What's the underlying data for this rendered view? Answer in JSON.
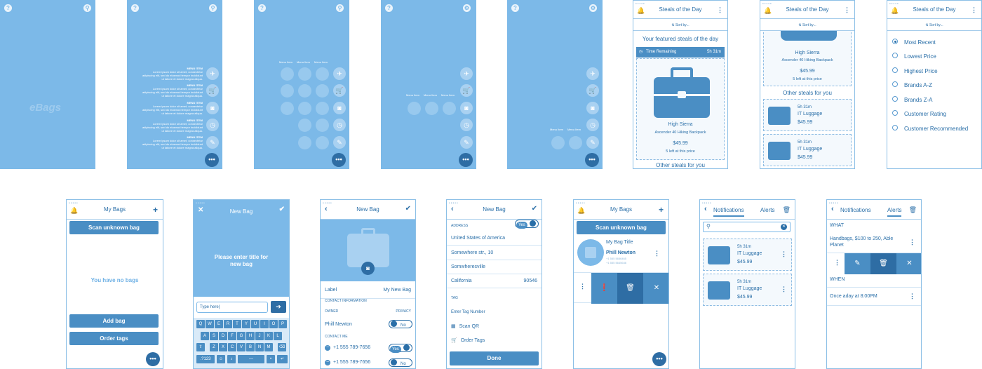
{
  "logo": "eBags",
  "sidemenu": {
    "items": [
      {
        "title": "MENU ITEM",
        "desc": "Lorem ipsum dolor sit amet, consectetur adipiscing elit, sed do eiusmod tempor incididunt ut labore et dolore magna aliqua."
      },
      {
        "title": "MENU ITEM",
        "desc": "Lorem ipsum dolor sit amet, consectetur adipiscing elit, sed do eiusmod tempor incididunt ut labore et dolore magna aliqua."
      },
      {
        "title": "MENU ITEM",
        "desc": "Lorem ipsum dolor sit amet, consectetur adipiscing elit, sed do eiusmod tempor incididunt ut labore et dolore magna aliqua."
      },
      {
        "title": "MENU ITEM",
        "desc": "Lorem ipsum dolor sit amet, consectetur adipiscing elit, sed do eiusmod tempor incididunt ut labore et dolore magna aliqua."
      },
      {
        "title": "MENU ITEM",
        "desc": "Lorem ipsum dolor sit amet, consectetur adipiscing elit, sed do eiusmod tempor incididunt ut labore et dolore magna aliqua."
      }
    ],
    "grid_label": "Menu Item"
  },
  "steals": {
    "title": "Steals of the Day",
    "sort": "Sort by...",
    "featured": "Your featured steals of the day",
    "time_label": "Time Remaining",
    "time": "5h 31m",
    "brand": "High Sierra",
    "product": "Ascender 40 Hiking Backpack",
    "price": "$45.99",
    "left": "5 left at this price",
    "other": "Other steals for you",
    "items": [
      {
        "time": "5h 31m",
        "name": "IT Luggage",
        "price": "$45.99"
      },
      {
        "time": "5h 31m",
        "name": "IT Luggage",
        "price": "$45.99"
      }
    ]
  },
  "sort_options": [
    "Most Recent",
    "Lowest Price",
    "Highest Price",
    "Brands A-Z",
    "Brands Z-A",
    "Customer Rating",
    "Customer Recommended"
  ],
  "mybags": {
    "title": "My Bags",
    "scan": "Scan unknown bag",
    "empty": "You have no bags",
    "add": "Add bag",
    "order": "Order tags",
    "bag_title": "My Bag Title",
    "owner": "Phill Newton",
    "phone1": "+1 555 5656465",
    "phone2": "+1 555 5645646"
  },
  "newbag": {
    "title": "New Bag",
    "prompt": "Please enter title for new bag",
    "input_value": "Type here|",
    "keys_row1": [
      "Q",
      "W",
      "E",
      "R",
      "T",
      "Y",
      "U",
      "I",
      "O",
      "P"
    ],
    "keys_row2": [
      "A",
      "S",
      "D",
      "F",
      "G",
      "H",
      "J",
      "K",
      "L"
    ],
    "keys_row3": [
      "Z",
      "X",
      "C",
      "V",
      "B",
      "N",
      "M"
    ],
    "key_123": ".?123",
    "label": "Label",
    "label_value": "My New Bag",
    "contact_info": "CONTACT INFORMATION",
    "owner_h": "OWNER",
    "privacy_h": "PRIVACY",
    "owner": "Phill Newton",
    "no": "No",
    "yes": "Yes",
    "contact_me": "CONTACT ME",
    "phone": "+1 555 789-7656",
    "address_h": "ADDRESS",
    "country": "United States of America",
    "street": "Somewhere str., 10",
    "city": "Somwheresville",
    "state": "California",
    "zip": "90546",
    "tag_h": "TAG",
    "tag_placeholder": "Enter Tag Number",
    "scan_qr": "Scan QR",
    "order_tags": "Order Tags",
    "done": "Done"
  },
  "notifications": {
    "tab1": "Notifications",
    "tab2": "Alerts",
    "items": [
      {
        "time": "5h 31m",
        "name": "IT Luggage",
        "price": "$45.99"
      },
      {
        "time": "5h 31m",
        "name": "IT Luggage",
        "price": "$45.99"
      }
    ],
    "what": "WHAT",
    "what_value": "Handbags, $100 to 250, Able Planet",
    "when": "WHEN",
    "when_value": "Once aday at 8:00PM"
  },
  "colors": {
    "primary": "#4a8ec4",
    "dark": "#2e6da4",
    "bg": "#7cb9e8"
  }
}
